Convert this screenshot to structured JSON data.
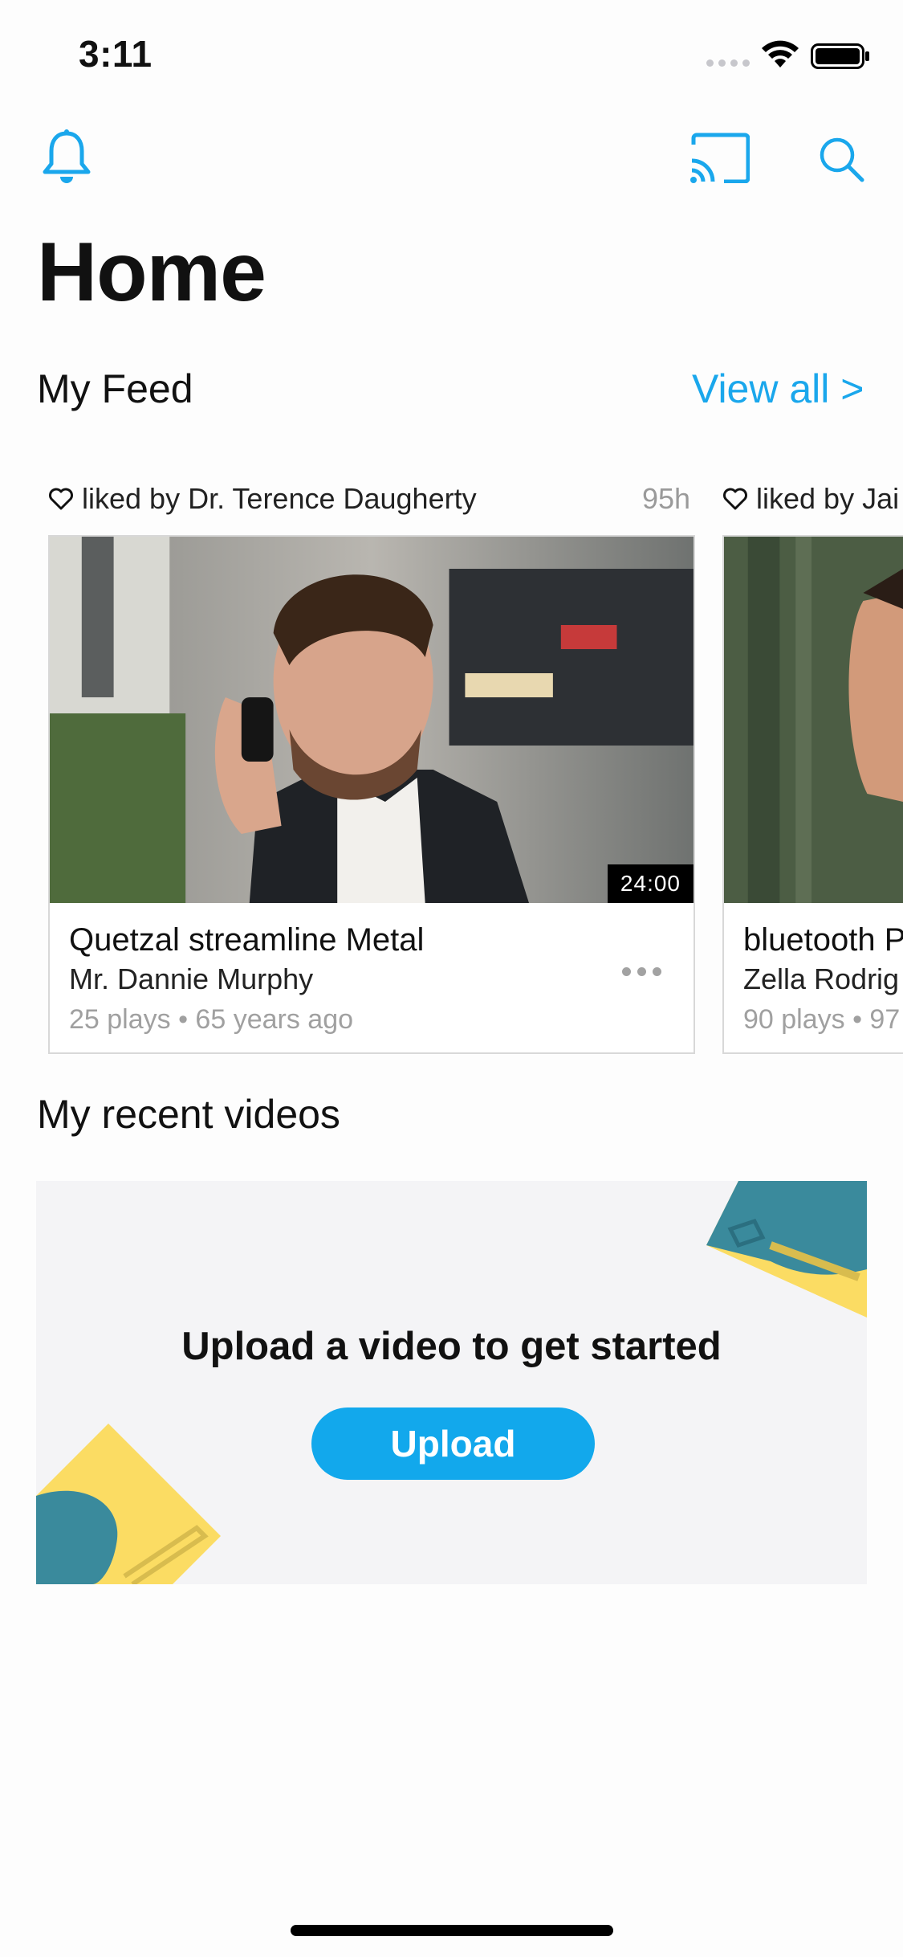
{
  "status_bar": {
    "time": "3:11"
  },
  "header": {
    "title": "Home"
  },
  "feed": {
    "title": "My Feed",
    "view_all": "View all >",
    "cards": [
      {
        "liked_by": "liked by Dr. Terence Daugherty",
        "time_ago": "95h",
        "duration": "24:00",
        "title": "Quetzal streamline Metal",
        "author": "Mr. Dannie Murphy",
        "stats": "25 plays • 65 years ago"
      },
      {
        "liked_by": "liked by Jai",
        "title": "bluetooth P",
        "author": "Zella Rodrig",
        "stats": "90 plays • 97"
      }
    ]
  },
  "recent": {
    "title": "My recent videos",
    "empty_message": "Upload a video to get started",
    "upload_label": "Upload"
  },
  "colors": {
    "accent": "#1aa7ec",
    "teal": "#3a8a9c",
    "yellow": "#fbdc63"
  },
  "icons": [
    "bell-icon",
    "cast-icon",
    "search-icon",
    "heart-icon",
    "more-icon"
  ]
}
